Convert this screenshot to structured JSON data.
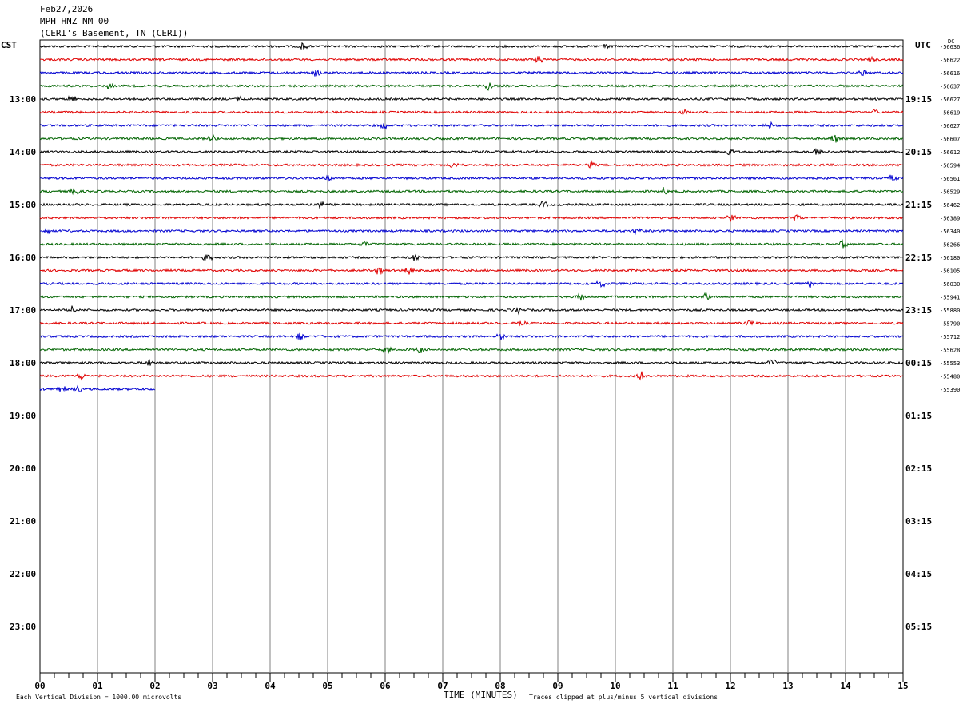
{
  "header": {
    "date": "Feb27,2026",
    "station": "MPH HNZ NM 00",
    "location": "(CERI's Basement, TN (CERI))"
  },
  "labels": {
    "left_tz": "CST",
    "right_tz": "UTC",
    "dc_label": "DC",
    "x_title": "TIME (MINUTES)",
    "scale_note": "Each Vertical Division = 1000.00 microvolts",
    "clip_note": "Traces clipped at plus/minus 5 vertical divisions"
  },
  "chart_data": {
    "type": "line",
    "title": "Feb27,2026 MPH HNZ NM 00 (CERI's Basement, TN (CERI))",
    "xlabel": "TIME (MINUTES)",
    "xlim": [
      0,
      15
    ],
    "x_ticks": [
      "00",
      "01",
      "02",
      "03",
      "04",
      "05",
      "06",
      "07",
      "08",
      "09",
      "10",
      "11",
      "12",
      "13",
      "14",
      "15"
    ],
    "grid": true,
    "left_time_labels": [
      "13:00",
      "14:00",
      "15:00",
      "16:00",
      "17:00",
      "18:00",
      "19:00",
      "20:00",
      "21:00",
      "22:00",
      "23:00"
    ],
    "right_time_labels": [
      "19:15",
      "20:15",
      "21:15",
      "22:15",
      "23:15",
      "00:15",
      "01:15",
      "02:15",
      "03:15",
      "04:15",
      "05:15"
    ],
    "trace_colors": [
      "#000000",
      "#e00000",
      "#0000d0",
      "#006400"
    ],
    "trace_count_total": 48,
    "trace_dc_offsets": [
      -56636,
      -56622,
      -56616,
      -56637,
      -56627,
      -56619,
      -56627,
      -56607,
      -56612,
      -56594,
      -56561,
      -56529,
      -56462,
      -56389,
      -56340,
      -56266,
      -56180,
      -56105,
      -56030,
      -55941,
      -55880,
      -55790,
      -55712,
      -55628,
      -55553,
      -55480,
      -55390
    ],
    "last_trace_length_minutes": 2.0,
    "scale_microvolts_per_division": 1000.0,
    "clip_divisions": 5
  }
}
